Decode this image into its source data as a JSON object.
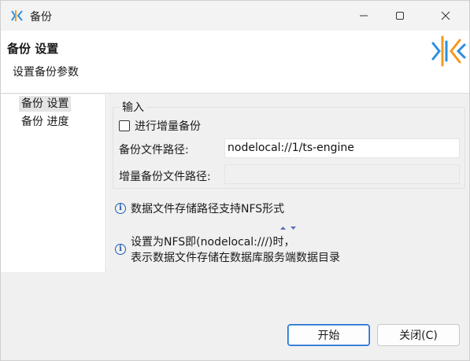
{
  "window": {
    "title": "备份",
    "icon": "xk-logo-icon"
  },
  "banner": {
    "title": "备份 设置",
    "subtitle": "设置备份参数"
  },
  "nav": {
    "items": [
      {
        "label": "备份 设置",
        "selected": true
      },
      {
        "label": "备份 进度",
        "selected": false
      }
    ]
  },
  "input_group": {
    "legend": "输入",
    "incremental_checkbox": {
      "label": "进行增量备份",
      "checked": false
    },
    "backup_path": {
      "label": "备份文件路径:",
      "value": "nodelocal://1/ts-engine"
    },
    "incremental_path": {
      "label": "增量备份文件路径:",
      "value": "",
      "enabled": false
    }
  },
  "notes": {
    "note1": "数据文件存储路径支持NFS形式",
    "note2_line1": "设置为NFS即(nodelocal:///)时，",
    "note2_line2": "表示数据文件存储在数据库服务端数据目录"
  },
  "footer": {
    "start_label": "开始",
    "close_label": "关闭(C)"
  },
  "colors": {
    "accent_blue": "#1f6fd0",
    "logo_orange": "#f29a1f",
    "logo_blue": "#2a8fe0"
  }
}
